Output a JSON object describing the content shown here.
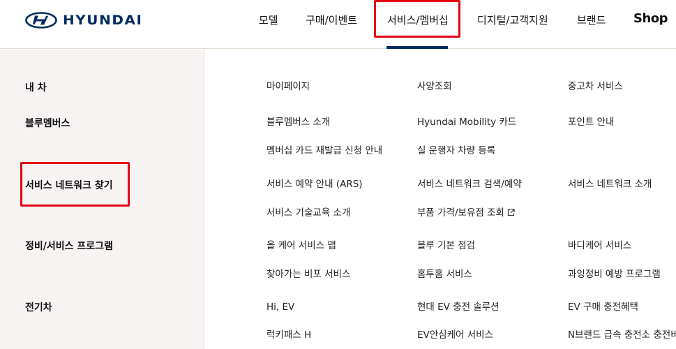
{
  "header": {
    "logo_text": "HYUNDAI",
    "nav": [
      "모델",
      "구매/이벤트",
      "서비스/멤버십",
      "디지털/고객지원",
      "브랜드"
    ],
    "shop_label": "Shop",
    "active_nav": "서비스/멤버십"
  },
  "sidebar": {
    "categories": [
      "내 차",
      "블루멤버스",
      "서비스 네트워크 찾기",
      "정비/서비스 프로그램",
      "전기차"
    ]
  },
  "menu": {
    "my_car": [
      "마이페이지",
      "사양조회",
      "중고차 서비스"
    ],
    "bluemembers": [
      "블루멤버스 소개",
      "Hyundai Mobility 카드",
      "포인트 안내",
      "멤버십 카드 재발급 신청 안내",
      "실 운행자 차량 등록"
    ],
    "service_network": [
      "서비스 예약 안내 (ARS)",
      "서비스 네트워크 검색/예약",
      "서비스 네트워크 소개",
      "서비스 기술교육 소개",
      "부품 가격/보유점 조회"
    ],
    "maintenance": [
      "올 케어 서비스 맵",
      "블루 기본 점검",
      "바디케어 서비스",
      "찾아가는 비포 서비스",
      "홈투홈 서비스",
      "과잉정비 예방 프로그램"
    ],
    "ev": [
      "Hi, EV",
      "현대 EV 충전 솔루션",
      "EV 구매 충전혜택",
      "럭키패스 H",
      "EV안심케어 서비스",
      "N브랜드 급속 충전소 충전비"
    ]
  },
  "colors": {
    "brand": "#002c5f",
    "highlight": "#e50012",
    "sidebar_bg": "#f6f3f2"
  }
}
